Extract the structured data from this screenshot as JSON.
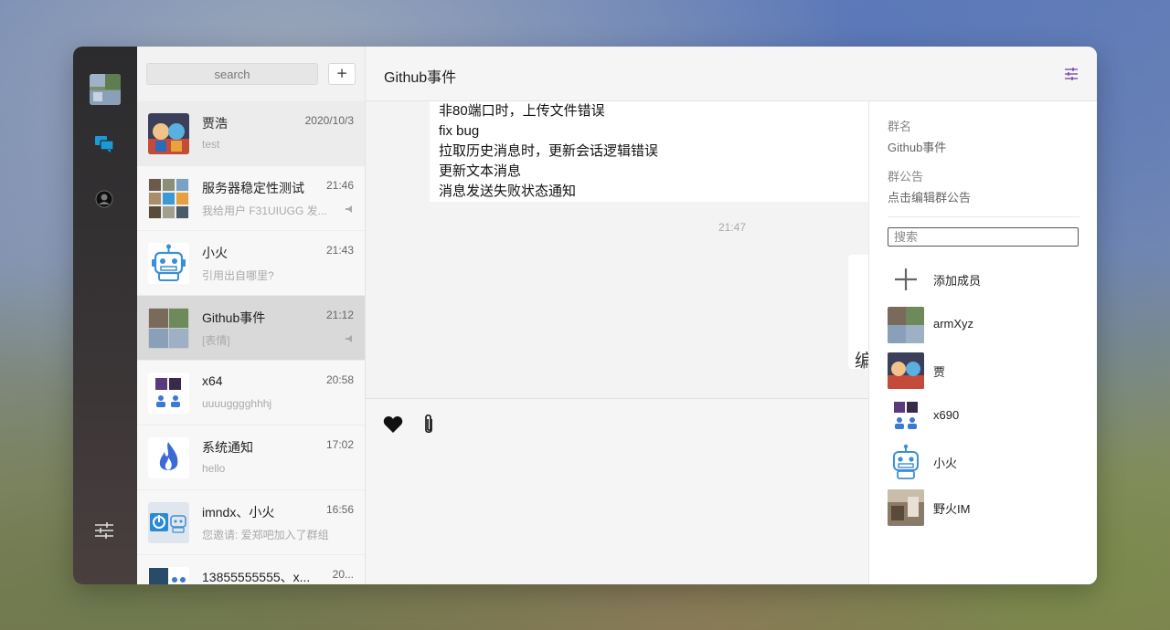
{
  "sidebar": {
    "icons": [
      "user-avatar",
      "chat-bubbles-icon",
      "contacts-icon",
      "settings-sliders-icon"
    ],
    "accent_color": "#1a9ad6"
  },
  "search": {
    "placeholder": "search",
    "add_label": "+"
  },
  "conversations": [
    {
      "name": "贾浩",
      "time": "2020/10/3",
      "last": "test",
      "muted": false
    },
    {
      "name": "服务器稳定性测试",
      "time": "21:46",
      "last": "我给用户 F31UIUGG 发...",
      "muted": true
    },
    {
      "name": "小火",
      "time": "21:43",
      "last": "引用出自哪里?",
      "muted": false
    },
    {
      "name": "Github事件",
      "time": "21:12",
      "last": "[表情]",
      "muted": true
    },
    {
      "name": "x64",
      "time": "20:58",
      "last": "uuuugggghhhj",
      "muted": false
    },
    {
      "name": "系统通知",
      "time": "17:02",
      "last": "hello",
      "muted": false
    },
    {
      "name": "imndx、小火",
      "time": "16:56",
      "last": "您邀请: 爱郑吧加入了群组",
      "muted": false
    },
    {
      "name": "13855555555、x...",
      "time": "20...",
      "last": "",
      "muted": false
    }
  ],
  "chat": {
    "title": "Github事件",
    "message_lines": [
      "非80端口时，上传文件错误",
      "fix bug",
      "拉取历史消息时，更新会话逻辑错误",
      "更新文本消息",
      "消息发送失败状态通知"
    ],
    "timestamp": "21:47",
    "peek_char": "编"
  },
  "drawer": {
    "group_name_label": "群名",
    "group_name": "Github事件",
    "notice_label": "群公告",
    "notice_value": "点击编辑群公告",
    "search_placeholder": "搜索",
    "add_member_label": "添加成员",
    "members": [
      {
        "name": "armXyz"
      },
      {
        "name": "贾"
      },
      {
        "name": "x690"
      },
      {
        "name": "小火"
      },
      {
        "name": "野火IM"
      }
    ]
  }
}
